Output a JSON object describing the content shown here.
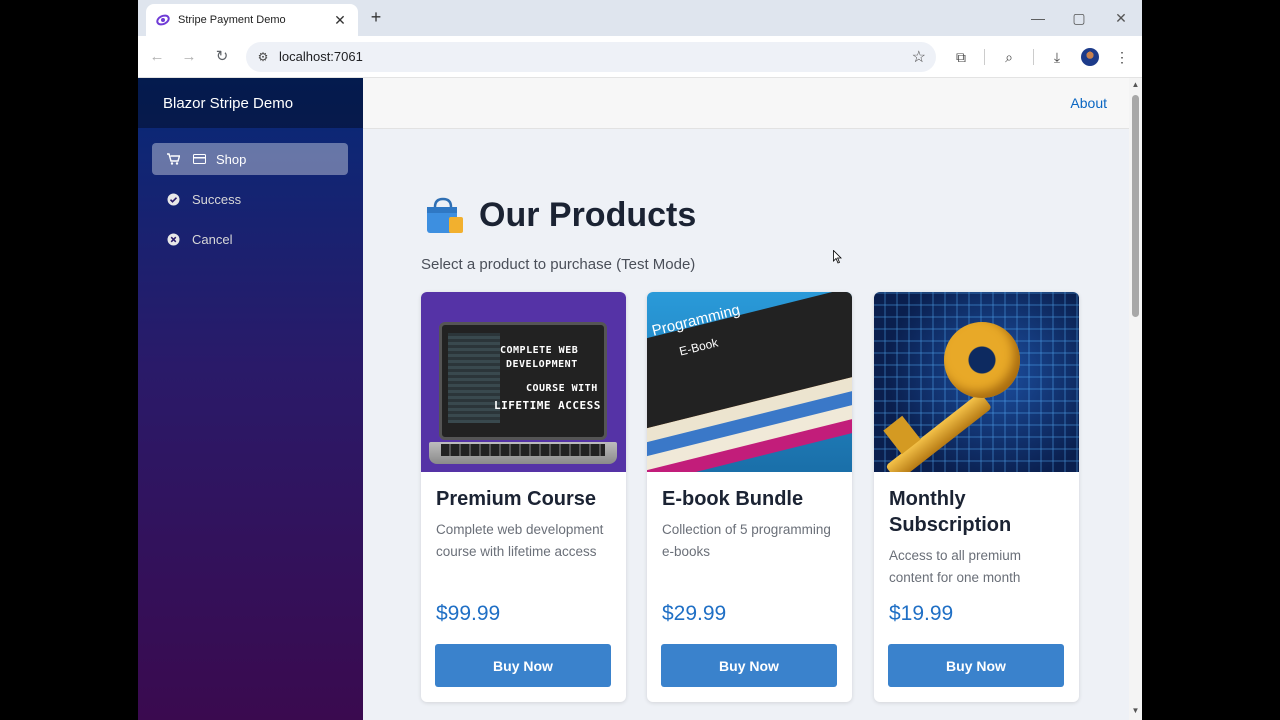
{
  "browser": {
    "tab_title": "Stripe Payment Demo",
    "tab_close": "✕",
    "new_tab": "+",
    "url": "localhost:7061"
  },
  "sidebar": {
    "brand": "Blazor Stripe Demo",
    "items": [
      {
        "label": "Shop",
        "icon": "cart-icon",
        "active": true
      },
      {
        "label": "Success",
        "icon": "check-circle-icon",
        "active": false
      },
      {
        "label": "Cancel",
        "icon": "x-circle-icon",
        "active": false
      }
    ]
  },
  "header": {
    "about_link": "About"
  },
  "main": {
    "title": "Our Products",
    "subtitle": "Select a product to purchase (Test Mode)",
    "buy_label": "Buy Now"
  },
  "products": [
    {
      "title": "Premium Course",
      "description": "Complete web development course with lifetime access",
      "price": "$99.99",
      "image_text": [
        "COMPLETE WEB",
        "DEVELOPMENT",
        "COURSE WITH",
        "LIFETIME ACCESS"
      ]
    },
    {
      "title": "E-book Bundle",
      "description": "Collection of 5 programming e-books",
      "price": "$29.99",
      "image_text": [
        "Programming",
        "E-Book"
      ]
    },
    {
      "title": "Monthly Subscription",
      "description": "Access to all premium content for one month",
      "price": "$19.99"
    }
  ],
  "colors": {
    "accent": "#3a82cc",
    "price": "#1f6fc5",
    "link": "#0a66c2"
  }
}
